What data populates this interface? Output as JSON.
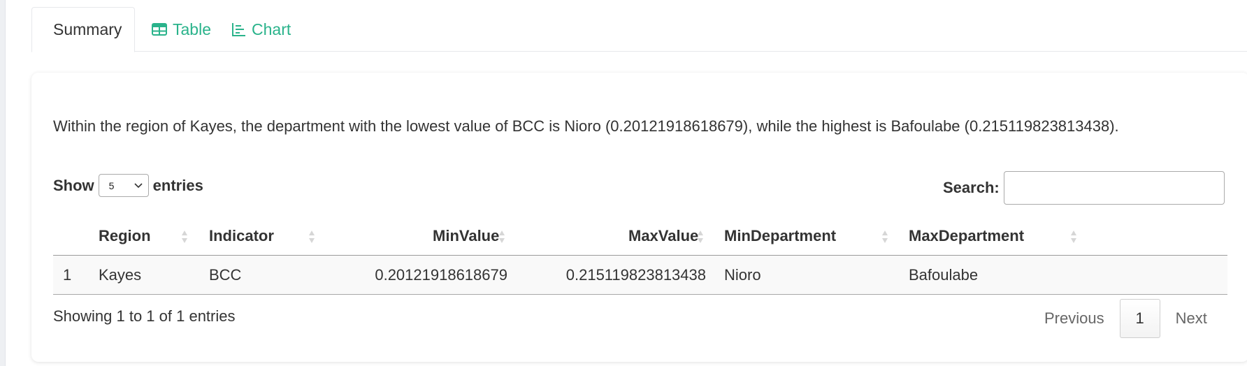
{
  "tabs": [
    {
      "label": "Summary",
      "icon": "lines-icon",
      "active": true
    },
    {
      "label": "Table",
      "icon": "table-icon",
      "active": false
    },
    {
      "label": "Chart",
      "icon": "chart-icon",
      "active": false
    }
  ],
  "summary_text": "Within the region of Kayes, the department with the lowest value of BCC is Nioro (0.20121918618679), while the highest is Bafoulabe (0.215119823813438).",
  "length_control": {
    "show_label": "Show",
    "selected": "5",
    "entries_label": "entries"
  },
  "search": {
    "label": "Search:",
    "value": ""
  },
  "table": {
    "columns": [
      "Region",
      "Indicator",
      "MinValue",
      "MaxValue",
      "MinDepartment",
      "MaxDepartment"
    ],
    "rows": [
      {
        "index": "1",
        "Region": "Kayes",
        "Indicator": "BCC",
        "MinValue": "0.20121918618679",
        "MaxValue": "0.215119823813438",
        "MinDepartment": "Nioro",
        "MaxDepartment": "Bafoulabe"
      }
    ]
  },
  "info": "Showing 1 to 1 of 1 entries",
  "pagination": {
    "previous": "Previous",
    "current": "1",
    "next": "Next"
  },
  "colors": {
    "accent": "#2ab38b",
    "text": "#333333"
  }
}
